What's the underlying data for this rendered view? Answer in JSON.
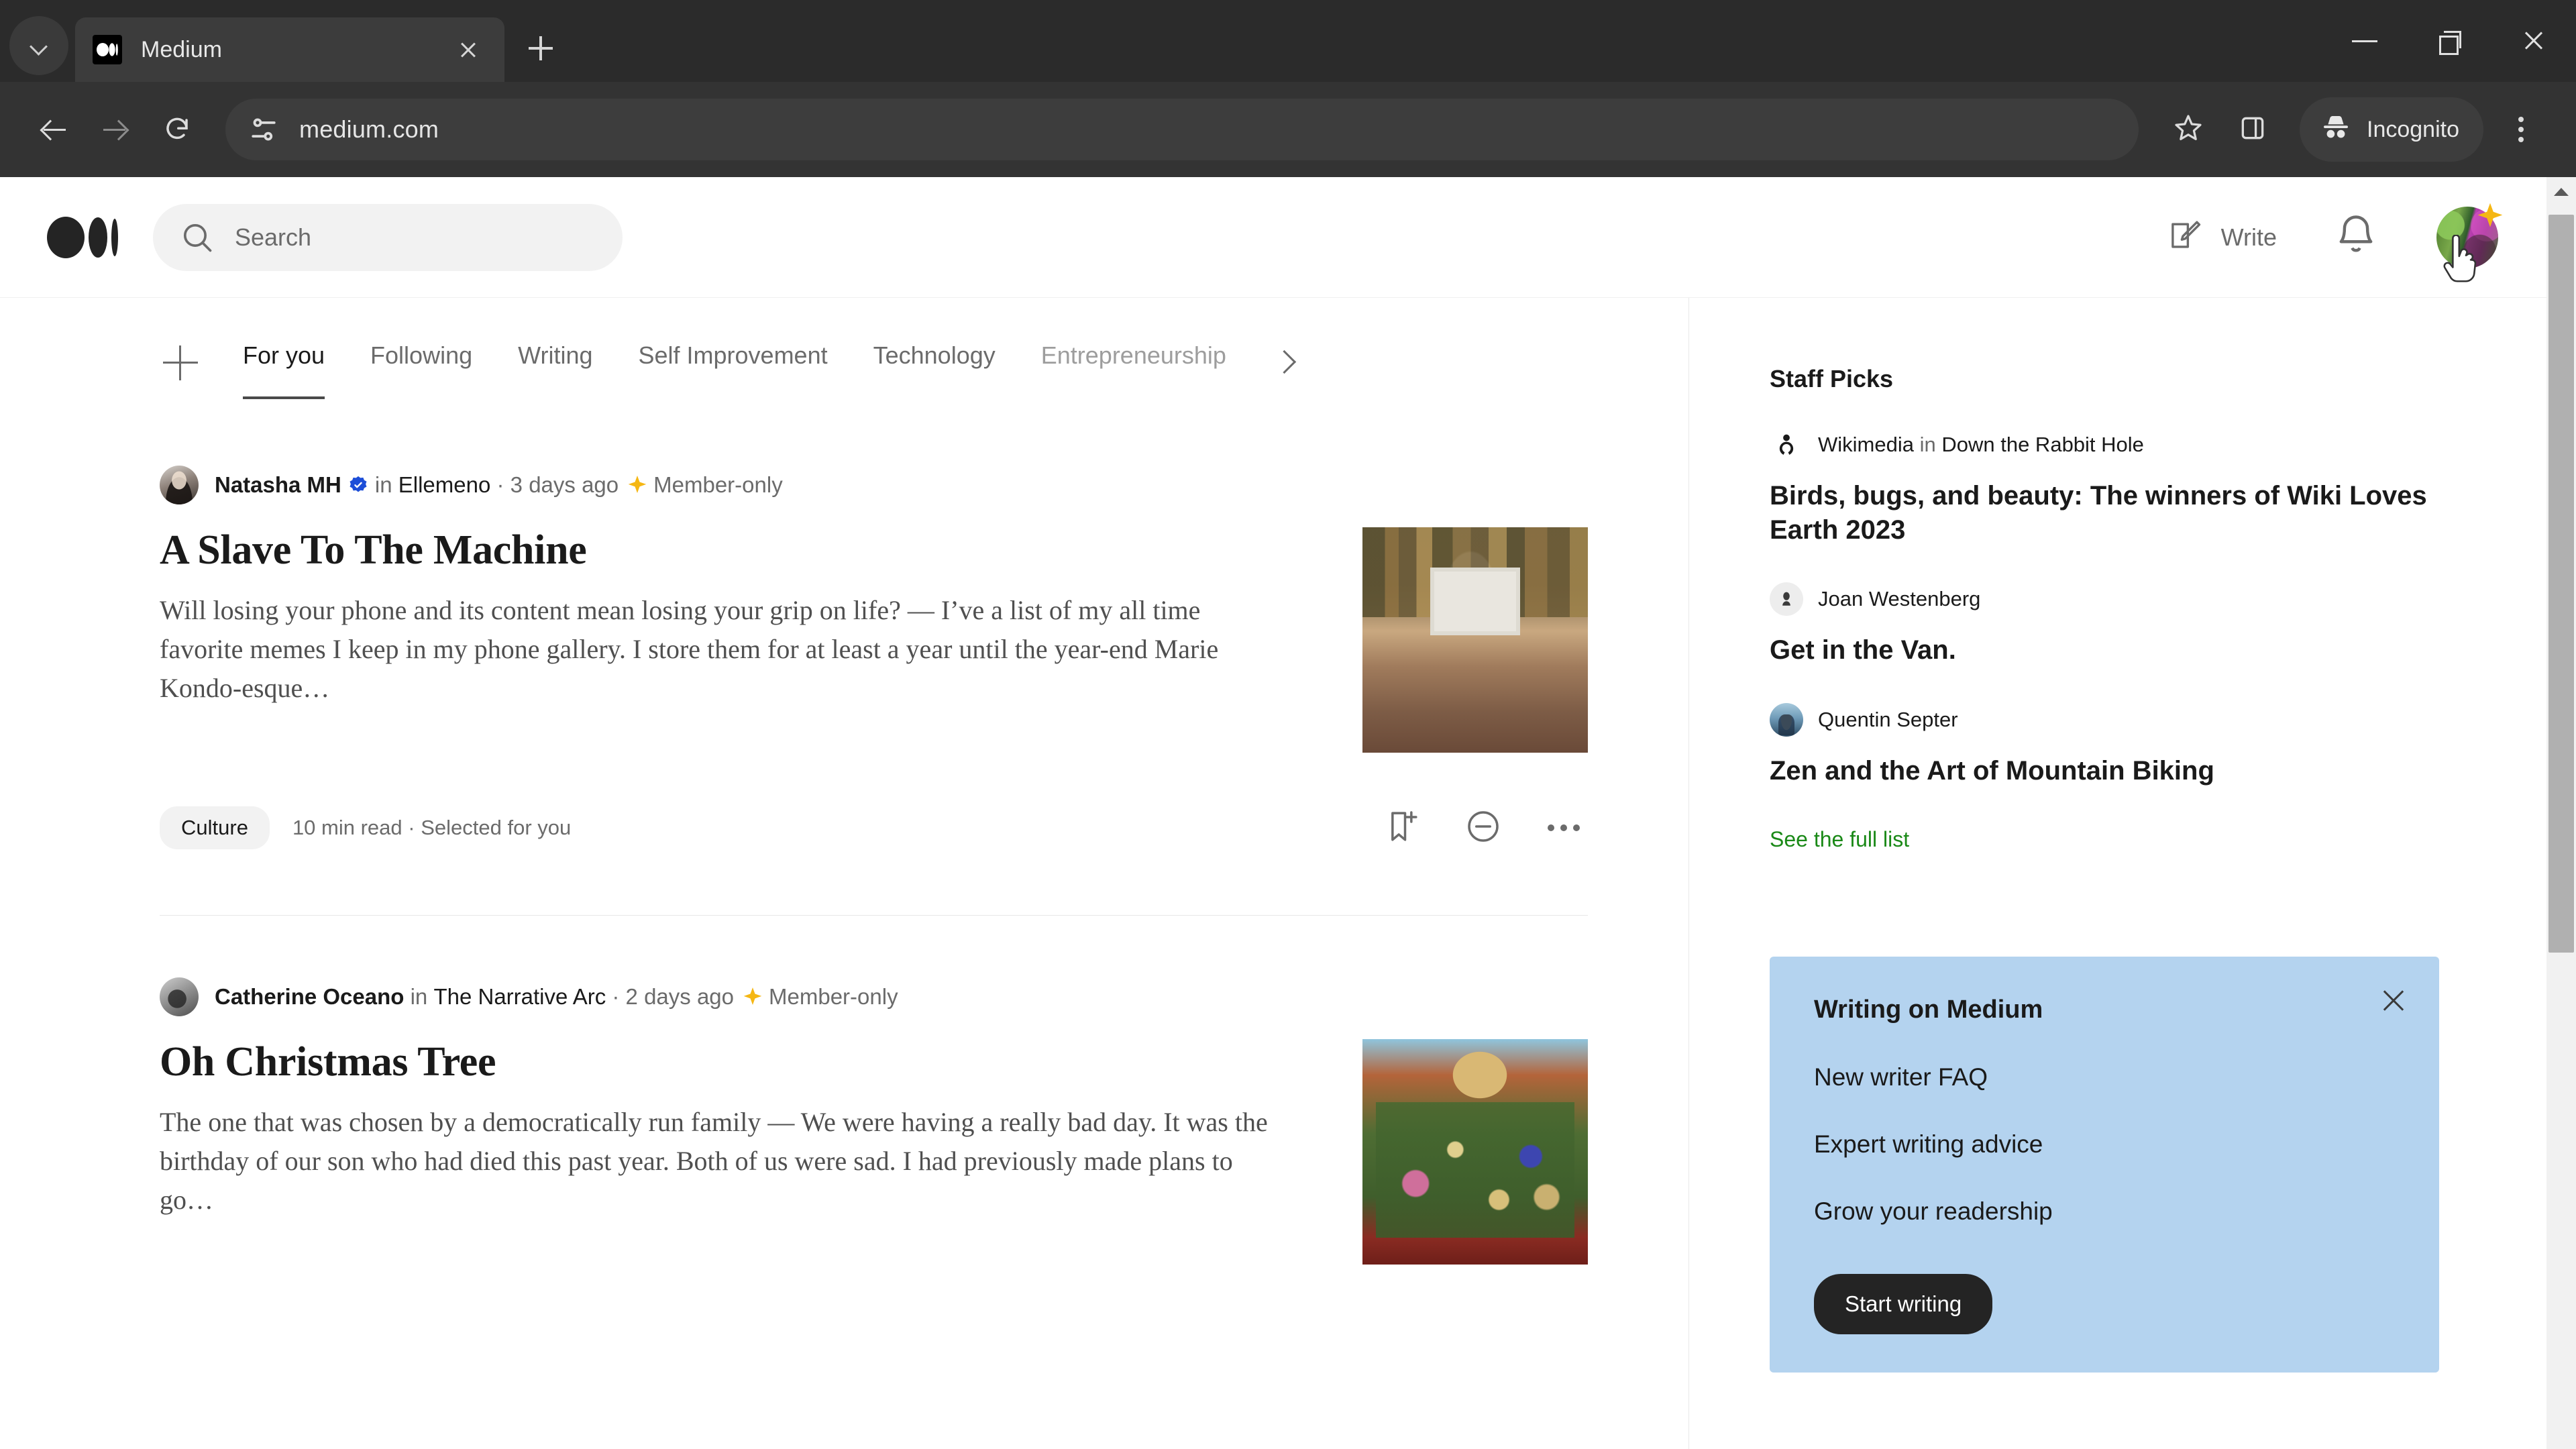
{
  "browser": {
    "tab": {
      "title": "Medium",
      "favicon": "medium-logo-icon"
    },
    "url": "medium.com",
    "profile_label": "Incognito",
    "icons": {
      "tab_search": "chevron-down-icon",
      "new_tab": "plus-icon",
      "back": "back-arrow-icon",
      "forward": "forward-arrow-icon",
      "reload": "reload-icon",
      "site_info": "tune-settings-icon",
      "bookmark": "star-icon",
      "side_panel": "side-panel-icon",
      "incognito": "incognito-hat-icon",
      "menu": "kebab-menu-icon",
      "minimize": "minimize-icon",
      "maximize": "maximize-icon",
      "close": "close-icon"
    }
  },
  "site_header": {
    "logo": "medium-wordmark-icon",
    "search": {
      "placeholder": "Search",
      "icon": "search-icon"
    },
    "write": {
      "label": "Write",
      "icon": "write-pencil-icon"
    },
    "notifications_icon": "bell-icon",
    "avatar": "user-avatar",
    "avatar_badge": "sparkle-icon"
  },
  "feed_tabs": {
    "add_icon": "plus-icon",
    "next_icon": "chevron-right-icon",
    "items": [
      {
        "label": "For you",
        "active": true
      },
      {
        "label": "Following",
        "active": false
      },
      {
        "label": "Writing",
        "active": false
      },
      {
        "label": "Self Improvement",
        "active": false
      },
      {
        "label": "Technology",
        "active": false
      },
      {
        "label": "Entrepreneurship",
        "active": false
      }
    ]
  },
  "articles": [
    {
      "author": "Natasha MH",
      "in_word": "in",
      "publication": "Ellemeno",
      "separator": "·",
      "date": "3 days ago",
      "member_only": "Member-only",
      "title": "A Slave To The Machine",
      "excerpt": "Will losing your phone and its content mean losing your grip on life? — I’ve a list of my all time favorite memes I keep in my phone gallery. I store them for at least a year until the year-end Marie Kondo-esque…",
      "tag": "Culture",
      "read_time": "10 min read",
      "reason": "Selected for you",
      "meta_separator": "·",
      "thumb": "museum-crowd-photo",
      "actions": {
        "save": "bookmark-plus-icon",
        "hide": "minus-circle-icon",
        "more": "more-options-icon"
      }
    },
    {
      "author": "Catherine Oceano",
      "in_word": "in",
      "publication": "The Narrative Arc",
      "separator": "·",
      "date": "2 days ago",
      "member_only": "Member-only",
      "title": "Oh Christmas Tree",
      "excerpt": "The one that was chosen by a democratically run family — We were having a really bad day. It was the birthday of our son who had died this past year. Both of us were sad. I had previously made plans to go…",
      "thumb": "christmas-tree-photo"
    }
  ],
  "sidebar": {
    "staff_picks_title": "Staff Picks",
    "picks": [
      {
        "author": "Wikimedia",
        "in_word": "in",
        "publication": "Down the Rabbit Hole",
        "title": "Birds, bugs, and beauty: The winners of Wiki Loves Earth 2023",
        "avatar": "wikimedia-logo-icon"
      },
      {
        "author": "Joan Westenberg",
        "in_word": "",
        "publication": "",
        "title": "Get in the Van.",
        "avatar": "joan-avatar"
      },
      {
        "author": "Quentin Septer",
        "in_word": "",
        "publication": "",
        "title": "Zen and the Art of Mountain Biking",
        "avatar": "quentin-avatar"
      }
    ],
    "see_full_list": "See the full list",
    "promo": {
      "title": "Writing on Medium",
      "close_icon": "close-icon",
      "links": [
        "New writer FAQ",
        "Expert writing advice",
        "Grow your readership"
      ],
      "button": "Start writing"
    }
  },
  "colors": {
    "medium_green": "#1a8917",
    "promo_blue": "#b4d3ef",
    "dark_button": "#242424",
    "chrome_dark": "#2b2b2b"
  }
}
